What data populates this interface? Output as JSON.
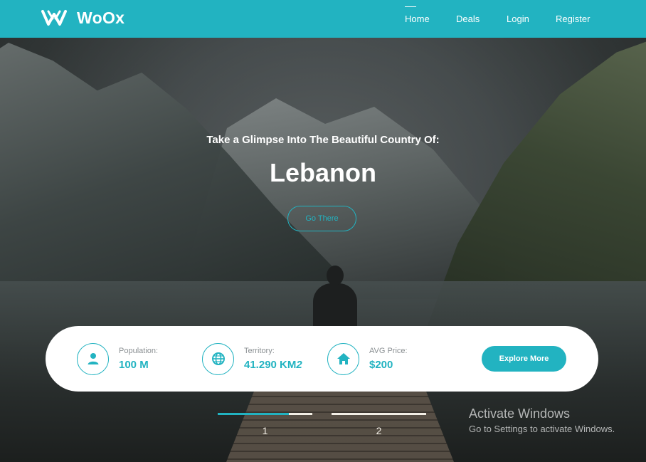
{
  "header": {
    "brand": "WoOx",
    "nav": [
      {
        "label": "Home",
        "active": true
      },
      {
        "label": "Deals",
        "active": false
      },
      {
        "label": "Login",
        "active": false
      },
      {
        "label": "Register",
        "active": false
      }
    ]
  },
  "hero": {
    "subtitle": "Take a Glimpse Into The Beautiful Country Of:",
    "title": "Lebanon",
    "cta_label": "Go There"
  },
  "stats": [
    {
      "icon": "user-icon",
      "label": "Population:",
      "value": "100 M",
      "suffix": ""
    },
    {
      "icon": "globe-icon",
      "label": "Territory:",
      "value": "41.290 KM",
      "suffix": "2"
    },
    {
      "icon": "home-icon",
      "label": "AVG Price:",
      "value": "$200",
      "suffix": ""
    }
  ],
  "explore_label": "Explore More",
  "slides": [
    {
      "label": "1",
      "progress": 0.75
    },
    {
      "label": "2",
      "progress": 0
    }
  ],
  "watermark": {
    "title": "Activate Windows",
    "subtitle": "Go to Settings to activate Windows."
  },
  "colors": {
    "accent": "#22b3c1",
    "white": "#ffffff",
    "slide_track": "#f3efe6"
  }
}
